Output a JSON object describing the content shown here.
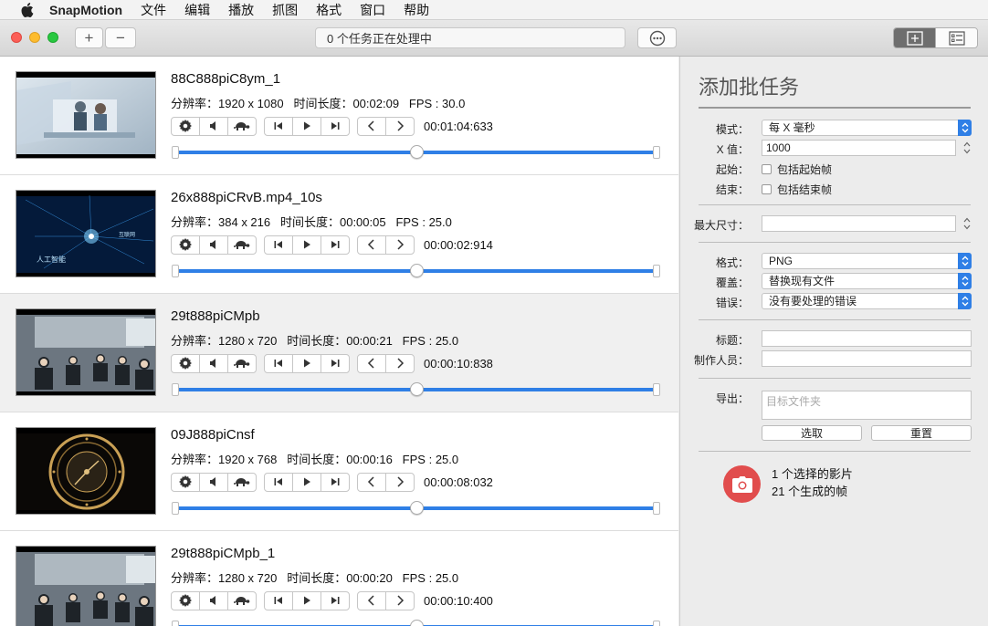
{
  "menubar": {
    "app_name": "SnapMotion",
    "items": [
      "文件",
      "编辑",
      "播放",
      "抓图",
      "格式",
      "窗口",
      "帮助"
    ]
  },
  "toolbar": {
    "add_label": "+",
    "remove_label": "−",
    "status_text": "0 个任务正在处理中"
  },
  "videos": [
    {
      "title": "88C888piC8ym_1",
      "resolution_label": "分辨率：",
      "resolution": "1920 x 1080",
      "duration_label": "时间长度：",
      "duration": "00:02:09",
      "fps_label": "FPS :",
      "fps": "30.0",
      "timecode": "00:01:04:633",
      "position": 0.5,
      "thumb": "office"
    },
    {
      "title": "26x888piCRvB.mp4_10s",
      "resolution_label": "分辨率：",
      "resolution": "384 x 216",
      "duration_label": "时间长度：",
      "duration": "00:00:05",
      "fps_label": "FPS :",
      "fps": "25.0",
      "timecode": "00:00:02:914",
      "position": 0.5,
      "thumb": "tech"
    },
    {
      "title": "29t888piCMpb",
      "resolution_label": "分辨率：",
      "resolution": "1280 x 720",
      "duration_label": "时间长度：",
      "duration": "00:00:21",
      "fps_label": "FPS :",
      "fps": "25.0",
      "timecode": "00:00:10:838",
      "position": 0.5,
      "thumb": "meeting"
    },
    {
      "title": "09J888piCnsf",
      "resolution_label": "分辨率：",
      "resolution": "1920 x 768",
      "duration_label": "时间长度：",
      "duration": "00:00:16",
      "fps_label": "FPS :",
      "fps": "25.0",
      "timecode": "00:00:08:032",
      "position": 0.5,
      "thumb": "clock"
    },
    {
      "title": "29t888piCMpb_1",
      "resolution_label": "分辨率：",
      "resolution": "1280 x 720",
      "duration_label": "时间长度：",
      "duration": "00:00:20",
      "fps_label": "FPS :",
      "fps": "25.0",
      "timecode": "00:00:10:400",
      "position": 0.5,
      "thumb": "meeting"
    }
  ],
  "panel": {
    "title": "添加批任务",
    "mode_label": "模式：",
    "mode_value": "每 X 毫秒",
    "x_label": "X 值：",
    "x_value": "1000",
    "start_label": "起始：",
    "start_check": "包括起始帧",
    "end_label": "结束：",
    "end_check": "包括结束帧",
    "maxsize_label": "最大尺寸：",
    "maxsize_value": "",
    "format_label": "格式：",
    "format_value": "PNG",
    "overwrite_label": "覆盖：",
    "overwrite_value": "替换现有文件",
    "error_label": "错误：",
    "error_value": "没有要处理的错误",
    "title_label": "标题：",
    "title_value": "",
    "author_label": "制作人员：",
    "author_value": "",
    "export_label": "导出：",
    "export_placeholder": "目标文件夹",
    "choose_button": "选取",
    "reset_button": "重置",
    "selected_count": "1 个选择的影片",
    "frames_count": "21 个生成的帧"
  },
  "colors": {
    "accent": "#2f7fe6",
    "camera": "#e14d4d",
    "close": "#fc5f57",
    "minimize": "#fdbc2e",
    "zoom": "#28c840"
  }
}
